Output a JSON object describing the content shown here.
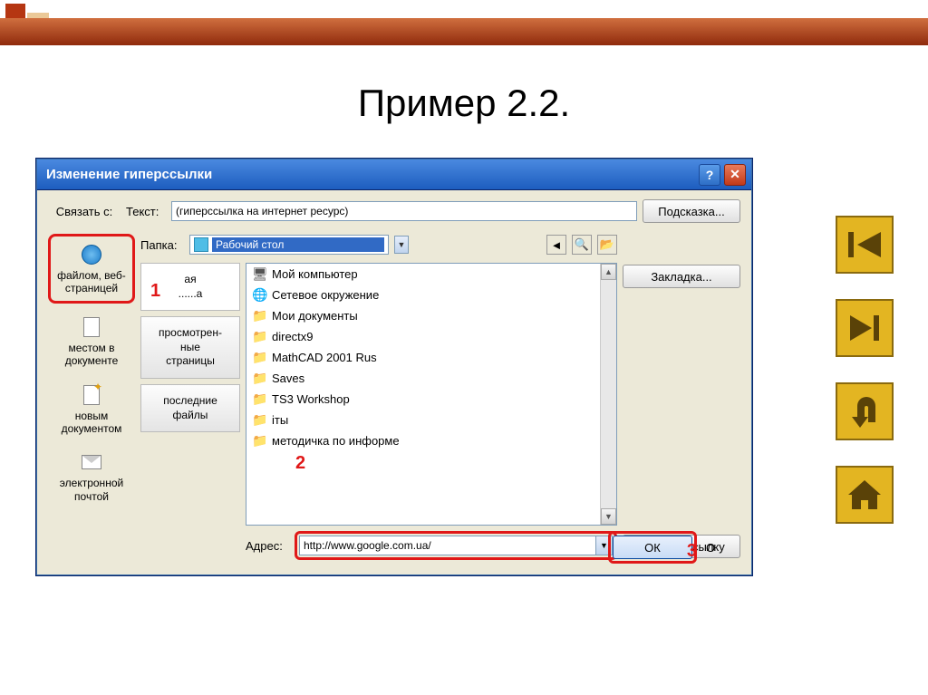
{
  "slide": {
    "title": "Пример 2.2."
  },
  "dialog": {
    "title": "Изменение гиперссылки",
    "linkWithLabel": "Связать с:",
    "textLabel": "Текст:",
    "textValue": "(гиперссылка на интернет ресурс)",
    "hintButton": "Подсказка...",
    "folderLabel": "Папка:",
    "folderValue": "Рабочий стол",
    "bookmarkButton": "Закладка...",
    "removeLinkButton": "Удалить ссылку",
    "addressLabel": "Адрес:",
    "addressValue": "http://www.google.com.ua/",
    "okButton": "ОК",
    "cancelFragment": "О",
    "linkTypes": [
      {
        "label": "файлом, веб-страницей"
      },
      {
        "label": "местом в документе"
      },
      {
        "label": "новым документом"
      },
      {
        "label": "электронной почтой"
      }
    ],
    "browseTabs": [
      {
        "label": "ая\n......а"
      },
      {
        "label": "просмотрен-\nные\nстраницы"
      },
      {
        "label": "последние\nфайлы"
      }
    ],
    "files": [
      {
        "icon": "comp",
        "name": "Мой компьютер"
      },
      {
        "icon": "net",
        "name": "Сетевое окружение"
      },
      {
        "icon": "folder",
        "name": "Мои документы"
      },
      {
        "icon": "folder",
        "name": "directx9"
      },
      {
        "icon": "folder",
        "name": "MathCAD 2001 Rus"
      },
      {
        "icon": "folder",
        "name": "Saves"
      },
      {
        "icon": "folder",
        "name": "TS3 Workshop"
      },
      {
        "icon": "folder",
        "name": "іты"
      },
      {
        "icon": "folder",
        "name": "методичка по информе"
      }
    ]
  },
  "callouts": {
    "n1": "1",
    "n2": "2",
    "n3": "3"
  }
}
